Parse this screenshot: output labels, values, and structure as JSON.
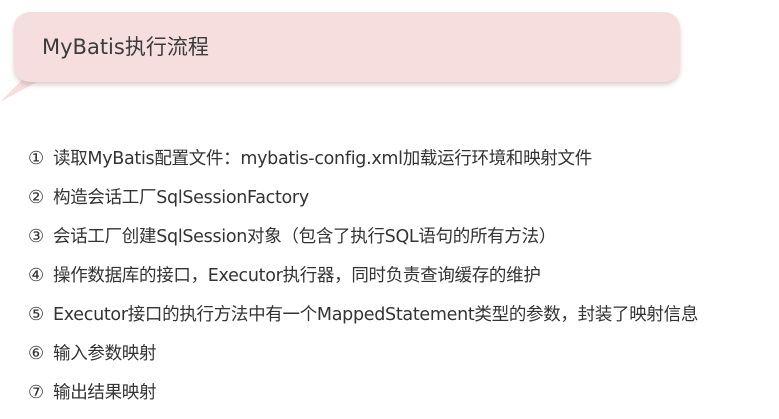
{
  "title": "MyBatis执行流程",
  "steps": [
    {
      "num": "①",
      "text": "读取MyBatis配置文件：mybatis-config.xml加载运行环境和映射文件"
    },
    {
      "num": "②",
      "text": "构造会话工厂SqlSessionFactory"
    },
    {
      "num": "③",
      "text": "会话工厂创建SqlSession对象（包含了执行SQL语句的所有方法）"
    },
    {
      "num": "④",
      "text": "操作数据库的接口，Executor执行器，同时负责查询缓存的维护"
    },
    {
      "num": "⑤",
      "text": "Executor接口的执行方法中有一个MappedStatement类型的参数，封装了映射信息"
    },
    {
      "num": "⑥",
      "text": "输入参数映射"
    },
    {
      "num": "⑦",
      "text": "输出结果映射"
    }
  ],
  "colors": {
    "bubble": "#f6dede",
    "text": "#333333"
  }
}
